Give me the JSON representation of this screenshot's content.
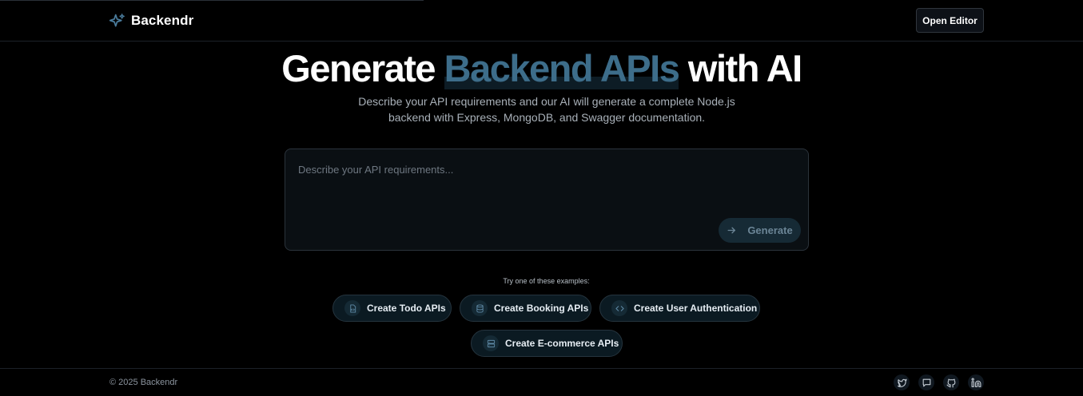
{
  "header": {
    "brand_name": "Backendr",
    "brand_icon": "sparkles-icon",
    "open_editor_label": "Open Editor"
  },
  "hero": {
    "title_prefix": "Generate",
    "title_accent": "Backend APIs",
    "title_suffix": "with AI",
    "subtitle": "Describe your API requirements and our AI will generate a complete Node.js backend with Express, MongoDB, and Swagger documentation."
  },
  "prompt": {
    "placeholder": "Describe your API requirements...",
    "value": "",
    "generate_label": "Generate",
    "generate_icon": "arrow-right-icon"
  },
  "examples": {
    "label": "Try one of these examples:",
    "items": [
      {
        "label": "Create Todo APIs",
        "icon": "file-code-icon"
      },
      {
        "label": "Create Booking APIs",
        "icon": "database-icon"
      },
      {
        "label": "Create User Authentication",
        "icon": "code-icon"
      },
      {
        "label": "Create E-commerce APIs",
        "icon": "server-icon"
      }
    ]
  },
  "footer": {
    "copyright": "© 2025 Backendr",
    "social": [
      "twitter-icon",
      "message-icon",
      "github-icon",
      "linkedin-icon"
    ]
  },
  "colors": {
    "background": "#000000",
    "accent": "#3d6d8a",
    "chip_bg": "#0b1a22",
    "generate_bg": "#162a35"
  }
}
